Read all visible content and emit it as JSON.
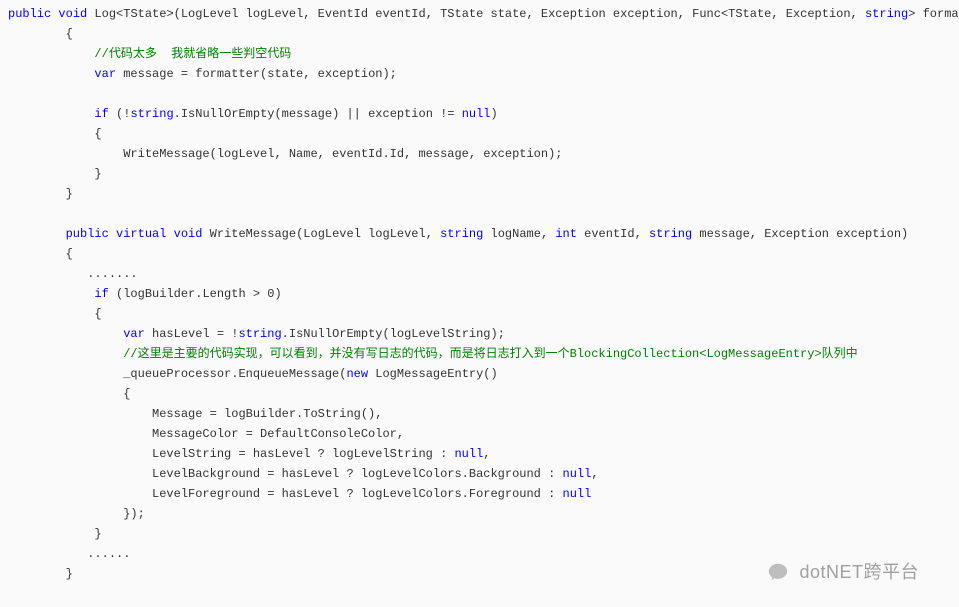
{
  "code": {
    "l1_p1": "public",
    "l1_p2": " ",
    "l1_p3": "void",
    "l1_p4": " Log<TState>(LogLevel logLevel, EventId eventId, TState state, Exception exception, Func<TState, Exception, ",
    "l1_p5": "string",
    "l1_p6": "> formatter)",
    "l2": "        {",
    "l3_p1": "            ",
    "l3_p2": "//代码太多  我就省略一些判空代码",
    "l4_p1": "            ",
    "l4_p2": "var",
    "l4_p3": " message = formatter(state, exception);",
    "l5": "",
    "l6_p1": "            ",
    "l6_p2": "if",
    "l6_p3": " (!",
    "l6_p4": "string",
    "l6_p5": ".IsNullOrEmpty(message) || exception != ",
    "l6_p6": "null",
    "l6_p7": ")",
    "l7": "            {",
    "l8": "                WriteMessage(logLevel, Name, eventId.Id, message, exception);",
    "l9": "            }",
    "l10": "        }",
    "l11": "",
    "l12_p1": "        ",
    "l12_p2": "public",
    "l12_p3": " ",
    "l12_p4": "virtual",
    "l12_p5": " ",
    "l12_p6": "void",
    "l12_p7": " WriteMessage(LogLevel logLevel, ",
    "l12_p8": "string",
    "l12_p9": " logName, ",
    "l12_p10": "int",
    "l12_p11": " eventId, ",
    "l12_p12": "string",
    "l12_p13": " message, Exception exception)",
    "l13": "        {",
    "l14": "           .......",
    "l15_p1": "            ",
    "l15_p2": "if",
    "l15_p3": " (logBuilder.Length > 0)",
    "l16": "            {",
    "l17_p1": "                ",
    "l17_p2": "var",
    "l17_p3": " hasLevel = !",
    "l17_p4": "string",
    "l17_p5": ".IsNullOrEmpty(logLevelString);",
    "l18_p1": "                ",
    "l18_p2": "//这里是主要的代码实现，可以看到，并没有写日志的代码，而是将日志打入到一个BlockingCollection<LogMessageEntry>队列中",
    "l19_p1": "                _queueProcessor.EnqueueMessage(",
    "l19_p2": "new",
    "l19_p3": " LogMessageEntry()",
    "l20": "                {",
    "l21": "                    Message = logBuilder.ToString(),",
    "l22": "                    MessageColor = DefaultConsoleColor,",
    "l23_p1": "                    LevelString = hasLevel ? logLevelString : ",
    "l23_p2": "null",
    "l23_p3": ",",
    "l24_p1": "                    LevelBackground = hasLevel ? logLevelColors.Background : ",
    "l24_p2": "null",
    "l24_p3": ",",
    "l25_p1": "                    LevelForeground = hasLevel ? logLevelColors.Foreground : ",
    "l25_p2": "null",
    "l26": "                });",
    "l27": "            }",
    "l28": "           ......",
    "l29": "        }"
  },
  "watermark": {
    "text": "dotNET跨平台"
  }
}
